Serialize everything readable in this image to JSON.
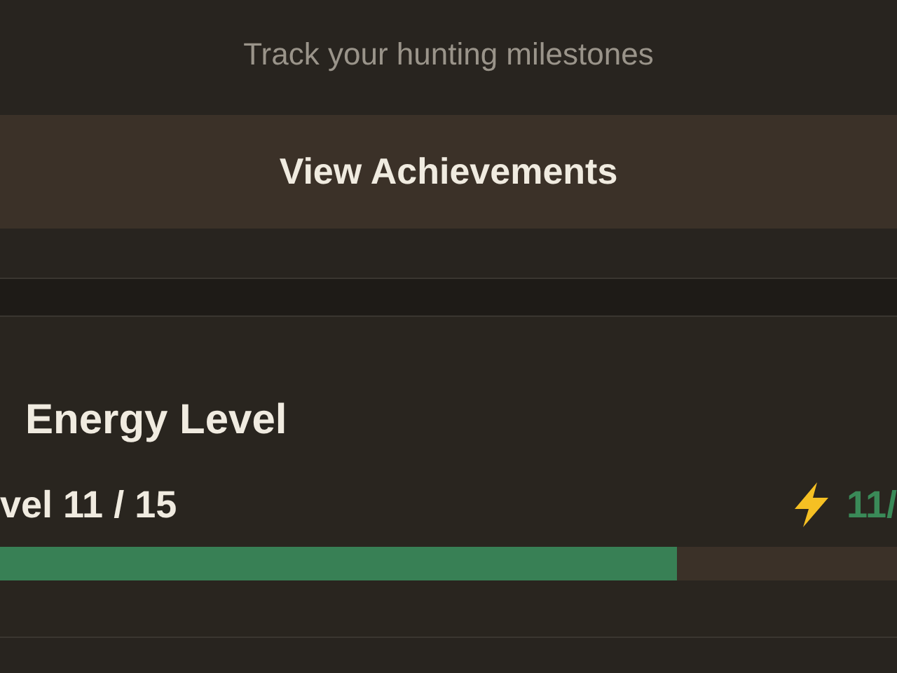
{
  "header": {
    "subtitle": "Track your hunting milestones"
  },
  "button": {
    "label": "View Achievements"
  },
  "energy": {
    "title": "Energy Level",
    "level_text": "vel 11 / 15",
    "reading": "11/",
    "level": 0.755
  }
}
